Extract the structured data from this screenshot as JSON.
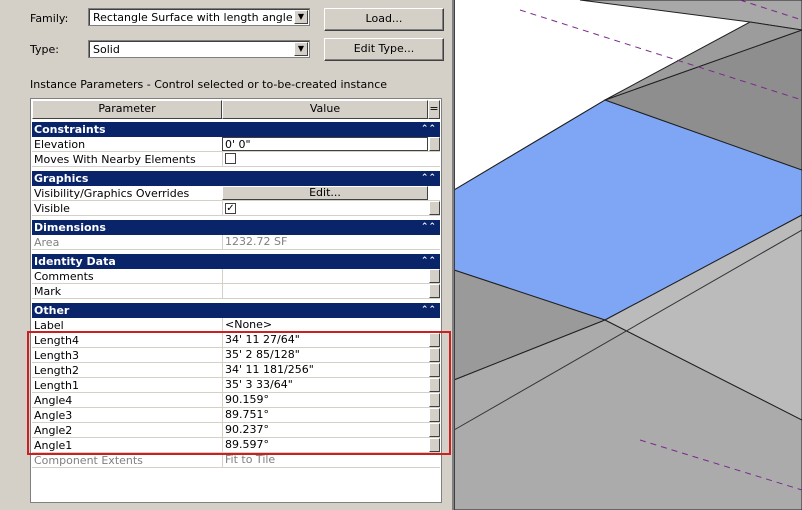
{
  "family": {
    "label": "Family:",
    "value": "Rectangle Surface with length angle parai"
  },
  "type": {
    "label": "Type:",
    "value": "Solid"
  },
  "buttons": {
    "load": "Load...",
    "edit_type": "Edit Type..."
  },
  "instance_caption": "Instance Parameters - Control selected or to-be-created instance",
  "grid_header": {
    "parameter": "Parameter",
    "value": "Value",
    "menu": "="
  },
  "sections": {
    "constraints": "Constraints",
    "graphics": "Graphics",
    "dimensions": "Dimensions",
    "identity": "Identity Data",
    "other": "Other"
  },
  "constraints": {
    "elevation_label": "Elevation",
    "elevation_value": "0'  0\"",
    "moves_label": "Moves With Nearby Elements",
    "moves_checked": false
  },
  "graphics": {
    "vis_label": "Visibility/Graphics Overrides",
    "vis_button": "Edit...",
    "visible_label": "Visible",
    "visible_checked": true
  },
  "dimensions": {
    "area_label": "Area",
    "area_value": "1232.72 SF"
  },
  "identity": {
    "comments_label": "Comments",
    "mark_label": "Mark"
  },
  "other": {
    "label_label": "Label",
    "label_value": "<None>",
    "rows": [
      {
        "name": "Length4",
        "value": "34'  11 27/64\""
      },
      {
        "name": "Length3",
        "value": "35'  2 85/128\""
      },
      {
        "name": "Length2",
        "value": "34'  11 181/256\""
      },
      {
        "name": "Length1",
        "value": "35'  3 33/64\""
      },
      {
        "name": "Angle4",
        "value": "90.159°"
      },
      {
        "name": "Angle3",
        "value": "89.751°"
      },
      {
        "name": "Angle2",
        "value": "90.237°"
      },
      {
        "name": "Angle1",
        "value": "89.597°"
      }
    ],
    "extents_label": "Component Extents",
    "extents_value": "Fit to Tile"
  },
  "colors": {
    "section_bar": "#0a246a",
    "highlight": "#cc2020",
    "surface_selected": "#7fa6f5",
    "surface_grey": "#a0a0a0"
  }
}
